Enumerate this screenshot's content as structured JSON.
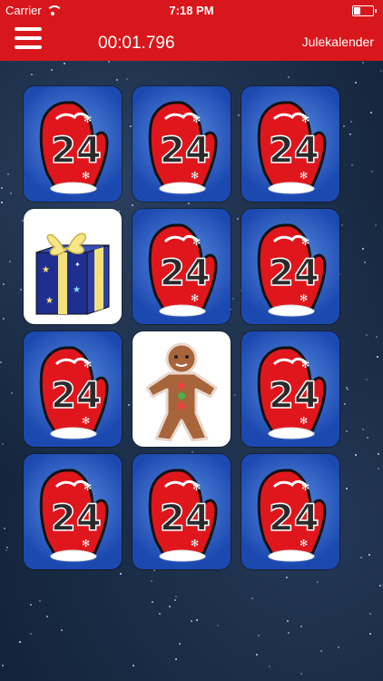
{
  "status_bar": {
    "carrier": "Carrier",
    "time": "7:18 PM",
    "battery_level": 0.35
  },
  "nav": {
    "timer": "00:01.796",
    "title": "Julekalender",
    "menu_icon": "hamburger-icon"
  },
  "board": {
    "cards": [
      {
        "state": "hidden",
        "label": "24"
      },
      {
        "state": "hidden",
        "label": "24"
      },
      {
        "state": "hidden",
        "label": "24"
      },
      {
        "state": "revealed",
        "item": "gift-box"
      },
      {
        "state": "hidden",
        "label": "24"
      },
      {
        "state": "hidden",
        "label": "24"
      },
      {
        "state": "hidden",
        "label": "24"
      },
      {
        "state": "revealed",
        "item": "gingerbread-man"
      },
      {
        "state": "hidden",
        "label": "24"
      },
      {
        "state": "hidden",
        "label": "24"
      },
      {
        "state": "hidden",
        "label": "24"
      },
      {
        "state": "hidden",
        "label": "24"
      }
    ]
  },
  "colors": {
    "bar": "#d8171c",
    "card_back": "#2a5bc4",
    "mitten": "#e0161d"
  }
}
